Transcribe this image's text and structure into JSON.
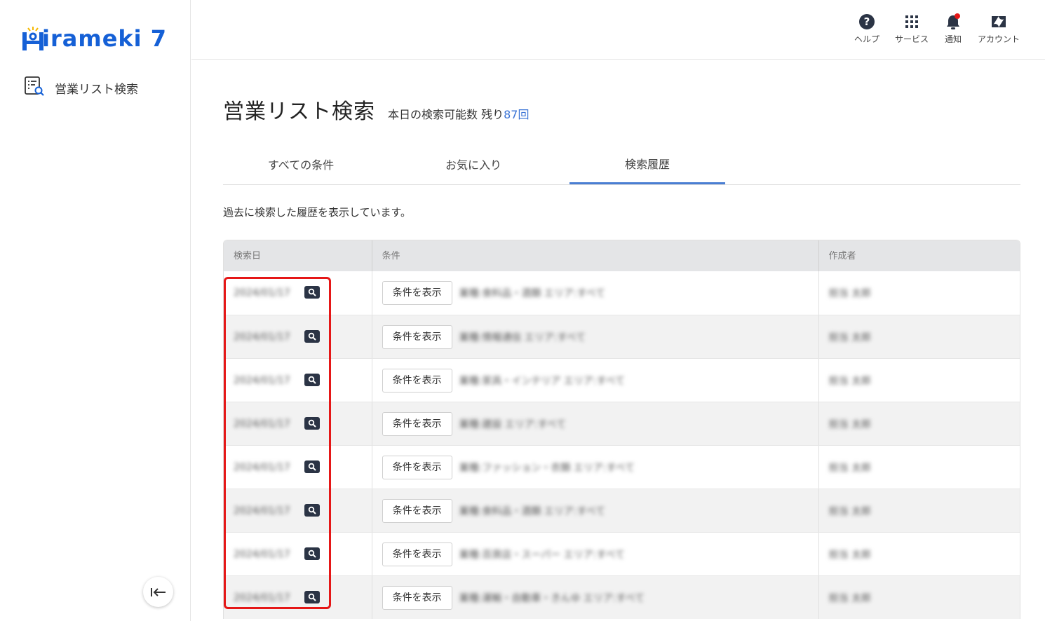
{
  "brand": {
    "logo_text": "irameki 7",
    "accent": "#1560d6"
  },
  "sidebar": {
    "items": [
      {
        "label": "営業リスト検索",
        "icon": "list-search-icon"
      }
    ],
    "collapse_icon": "collapse-left-icon"
  },
  "header": {
    "items": [
      {
        "label": "ヘルプ",
        "icon": "help-icon"
      },
      {
        "label": "サービス",
        "icon": "grid-icon"
      },
      {
        "label": "通知",
        "icon": "bell-icon"
      },
      {
        "label": "アカウント",
        "icon": "zendesk-icon"
      }
    ]
  },
  "page": {
    "title": "営業リスト検索",
    "quota_prefix": "本日の検索可能数 残り",
    "quota_count": "87回"
  },
  "tabs": [
    {
      "label": "すべての条件",
      "active": false
    },
    {
      "label": "お気に入り",
      "active": false
    },
    {
      "label": "検索履歴",
      "active": true
    }
  ],
  "description": "過去に検索した履歴を表示しています。",
  "table": {
    "headers": [
      "検索日",
      "条件",
      "作成者"
    ],
    "rows": [
      {
        "date": "2024/01/17",
        "condition": "業種:食料品・酒類 エリア:すべて",
        "author": "担当 太郎"
      },
      {
        "date": "2024/01/17",
        "condition": "業種:情報通信 エリア:すべて",
        "author": "担当 太郎"
      },
      {
        "date": "2024/01/17",
        "condition": "業種:家具・インテリア エリア:すべて",
        "author": "担当 太郎"
      },
      {
        "date": "2024/01/17",
        "condition": "業種:建設 エリア:すべて",
        "author": "担当 太郎"
      },
      {
        "date": "2024/01/17",
        "condition": "業種:ファッション・衣類 エリア:すべて",
        "author": "担当 太郎"
      },
      {
        "date": "2024/01/17",
        "condition": "業種:食料品・酒類 エリア:すべて",
        "author": "担当 太郎"
      },
      {
        "date": "2024/01/17",
        "condition": "業種:百貨店・スーパー エリア:すべて",
        "author": "担当 太郎"
      },
      {
        "date": "2024/01/17",
        "condition": "業種:運輸・自動車・きんゆ エリア:すべて",
        "author": "担当 太郎"
      }
    ],
    "condition_button_label": "条件を表示"
  },
  "colors": {
    "tab_active": "#4a7ed3",
    "highlight": "#e51717",
    "quota_count": "#3b74d6"
  }
}
